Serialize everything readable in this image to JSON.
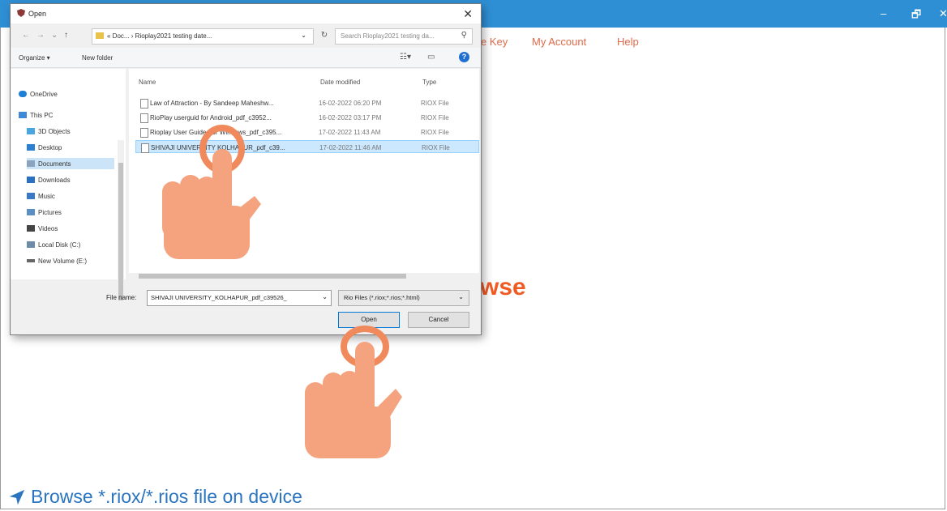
{
  "app": {
    "nav": [
      {
        "label": "e Key"
      },
      {
        "label": "My Account"
      },
      {
        "label": "Help"
      }
    ],
    "window_controls": {
      "minimize": "–",
      "maximize": "🗗",
      "close": "✕"
    },
    "browse_heading": "wse",
    "footer_link": "Browse *.riox/*.rios file on device",
    "colors": {
      "titlebar": "#2f8fd4",
      "accent": "#f05a23",
      "link": "#2a74c0"
    }
  },
  "dialog": {
    "title": "Open",
    "close": "✕",
    "address_path": "« Doc... › Rioplay2021 testing date...",
    "search_placeholder": "Search Rioplay2021 testing da...",
    "toolbar": {
      "organize": "Organize ▾",
      "new_folder": "New folder"
    },
    "nav_items": [
      {
        "label": "OneDrive",
        "icon": "cloud-icon"
      },
      {
        "label": "This PC",
        "icon": "computer-icon"
      },
      {
        "label": "3D Objects",
        "icon": "cube-icon"
      },
      {
        "label": "Desktop",
        "icon": "desktop-icon"
      },
      {
        "label": "Documents",
        "icon": "documents-icon"
      },
      {
        "label": "Downloads",
        "icon": "download-icon"
      },
      {
        "label": "Music",
        "icon": "music-icon"
      },
      {
        "label": "Pictures",
        "icon": "pictures-icon"
      },
      {
        "label": "Videos",
        "icon": "video-icon"
      },
      {
        "label": "Local Disk (C:)",
        "icon": "drive-icon"
      },
      {
        "label": "New Volume (E:)",
        "icon": "drive-icon"
      }
    ],
    "columns": {
      "name": "Name",
      "date": "Date modified",
      "type": "Type"
    },
    "files": [
      {
        "name": "Law of Attraction - By Sandeep Maheshw...",
        "date": "16-02-2022 06:20 PM",
        "type": "RIOX File"
      },
      {
        "name": "RioPlay userguid for Android_pdf_c3952...",
        "date": "16-02-2022 03:17 PM",
        "type": "RIOX File"
      },
      {
        "name": "Rioplay User Guide For Windows_pdf_c395...",
        "date": "17-02-2022 11:43 AM",
        "type": "RIOX File"
      },
      {
        "name": "SHIVAJI UNIVERSITY KOLHAPUR_pdf_c39...",
        "date": "17-02-2022 11:46 AM",
        "type": "RIOX File"
      }
    ],
    "file_name_label": "File name:",
    "file_name_value": "SHIVAJI UNIVERSITY_KOLHAPUR_pdf_c39526_",
    "file_type_value": "Rio Files (*.riox;*.rios;*.html)",
    "open_label": "Open",
    "cancel_label": "Cancel"
  }
}
